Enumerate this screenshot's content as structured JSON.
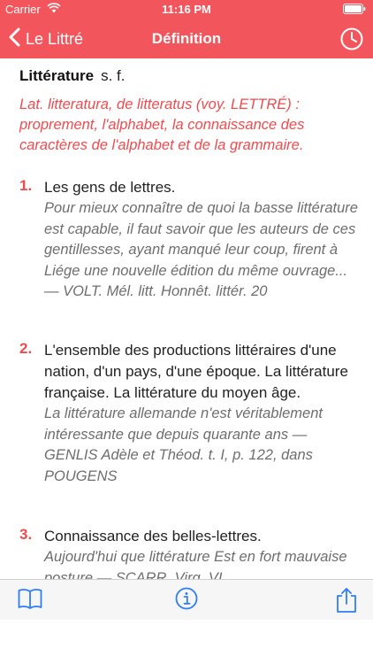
{
  "status_bar": {
    "carrier": "Carrier",
    "time": "11:16 PM"
  },
  "nav": {
    "back_label": "Le Littré",
    "title": "Définition"
  },
  "entry": {
    "headword": "Littérature",
    "pos": "s. f.",
    "etymology": "Lat. litteratura, de litteratus (voy. LETTRÉ) : proprement, l'alphabet, la connaissance des caractères de l'alphabet et de la grammaire.",
    "senses": [
      {
        "number": "1.",
        "definition": "Les gens de lettres.",
        "example": "Pour mieux connaître de quoi la basse littérature est capable, il faut savoir que les auteurs de ces gentillesses, ayant manqué leur coup, firent à Liége une nouvelle édition du même ouvrage... — VOLT. Mél. litt. Honnêt. littér. 20"
      },
      {
        "number": "2.",
        "definition": "L'ensemble des productions littéraires d'une nation, d'un pays, d'une époque. La littérature française. La littérature du moyen âge.",
        "example": "La littérature allemande n'est véritablement intéressante que depuis quarante ans — GENLIS Adèle et Théod. t. I, p. 122, dans POUGENS"
      },
      {
        "number": "3.",
        "definition": "Connaissance des belles-lettres.",
        "example": "Aujourd'hui que littérature Est en fort mauvaise posture — SCARR. Virg. VI"
      }
    ]
  },
  "colors": {
    "accent": "#f2555b",
    "sense_number": "#ef4b4f",
    "example": "#6e6e6e",
    "toolbar_icon": "#2f7ef6"
  },
  "icons": {
    "back": "chevron-left-icon",
    "history": "clock-icon",
    "book": "book-icon",
    "info": "info-icon",
    "share": "share-icon"
  }
}
